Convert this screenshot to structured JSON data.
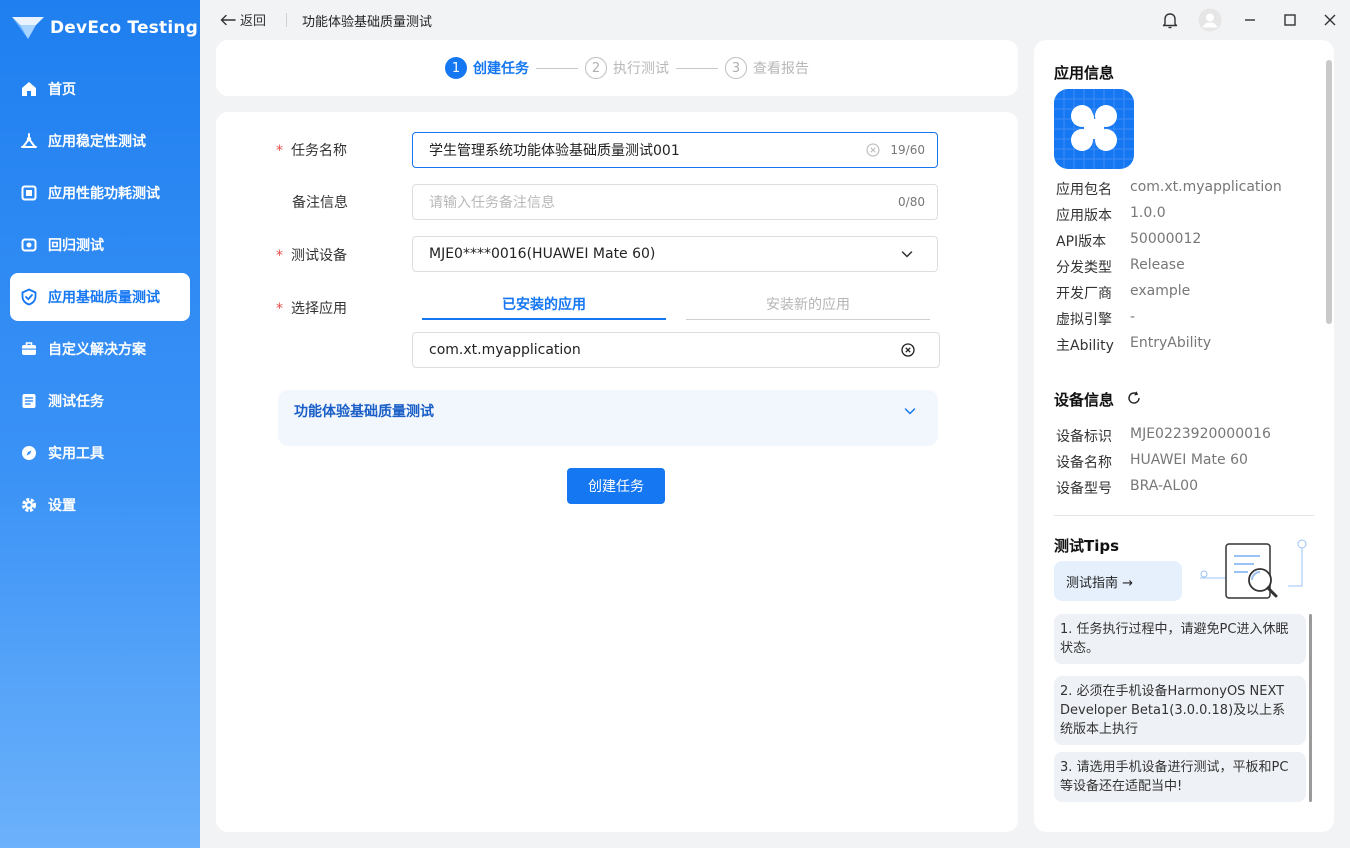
{
  "app": {
    "name": "DevEco Testing"
  },
  "sidebar": {
    "items": [
      {
        "label": "首页",
        "icon": "home-icon",
        "active": false
      },
      {
        "label": "应用稳定性测试",
        "icon": "stability-icon",
        "active": false
      },
      {
        "label": "应用性能功耗测试",
        "icon": "performance-icon",
        "active": false
      },
      {
        "label": "回归测试",
        "icon": "regression-icon",
        "active": false
      },
      {
        "label": "应用基础质量测试",
        "icon": "shield-check-icon",
        "active": true
      },
      {
        "label": "自定义解决方案",
        "icon": "briefcase-icon",
        "active": false
      },
      {
        "label": "测试任务",
        "icon": "task-list-icon",
        "active": false
      },
      {
        "label": "实用工具",
        "icon": "compass-icon",
        "active": false
      },
      {
        "label": "设置",
        "icon": "gear-icon",
        "active": false
      }
    ]
  },
  "header": {
    "back_label": "返回",
    "title": "功能体验基础质量测试"
  },
  "stepper": {
    "steps": [
      {
        "num": "1",
        "label": "创建任务",
        "state": "active"
      },
      {
        "num": "2",
        "label": "执行测试",
        "state": "inactive"
      },
      {
        "num": "3",
        "label": "查看报告",
        "state": "inactive"
      }
    ]
  },
  "form": {
    "task_name": {
      "label": "任务名称",
      "value": "学生管理系统功能体验基础质量测试001",
      "count": "19/60"
    },
    "remark": {
      "label": "备注信息",
      "placeholder": "请输入任务备注信息",
      "count": "0/80"
    },
    "device": {
      "label": "测试设备",
      "value": "MJE0****0016(HUAWEI Mate 60)"
    },
    "app_select": {
      "label": "选择应用",
      "tabs": [
        "已安装的应用",
        "安装新的应用"
      ],
      "value": "com.xt.myapplication"
    },
    "section_title": "功能体验基础质量测试",
    "submit_label": "创建任务"
  },
  "app_info": {
    "title": "应用信息",
    "rows": [
      {
        "k": "应用包名",
        "v": "com.xt.myapplication"
      },
      {
        "k": "应用版本",
        "v": "1.0.0"
      },
      {
        "k": "API版本",
        "v": "50000012"
      },
      {
        "k": "分发类型",
        "v": "Release"
      },
      {
        "k": "开发厂商",
        "v": "example"
      },
      {
        "k": "虚拟引擎",
        "v": "-"
      },
      {
        "k": "主Ability",
        "v": "EntryAbility"
      }
    ]
  },
  "device_info": {
    "title": "设备信息",
    "rows": [
      {
        "k": "设备标识",
        "v": "MJE0223920000016"
      },
      {
        "k": "设备名称",
        "v": "HUAWEI Mate 60"
      },
      {
        "k": "设备型号",
        "v": "BRA-AL00"
      }
    ]
  },
  "tips": {
    "title": "测试Tips",
    "guide_label": "测试指南 →",
    "items": [
      "1. 任务执行过程中，请避免PC进入休眠状态。",
      "2. 必须在手机设备HarmonyOS NEXT Developer Beta1(3.0.0.18)及以上系统版本上执行",
      "3. 请选用手机设备进行测试，平板和PC等设备还在适配当中!"
    ]
  },
  "colors": {
    "accent": "#1677f2",
    "required": "#e84b4b"
  }
}
